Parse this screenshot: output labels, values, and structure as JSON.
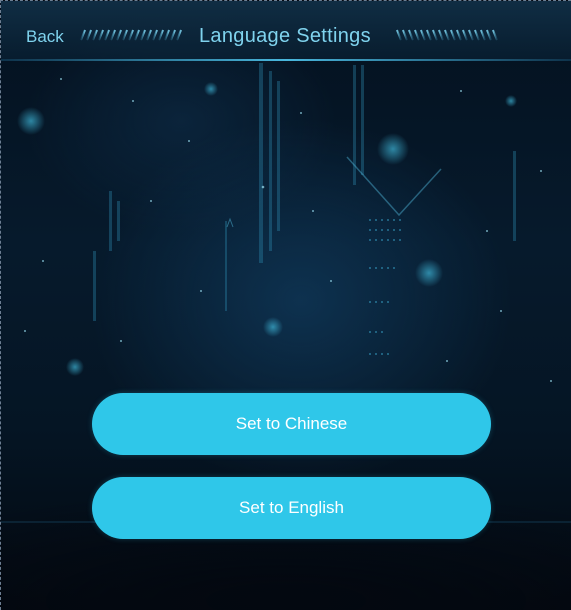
{
  "header": {
    "back_label": "Back",
    "title": "Language Settings"
  },
  "buttons": {
    "chinese_label": "Set to Chinese",
    "english_label": "Set to English"
  },
  "colors": {
    "accent": "#2fc7e9",
    "header_text": "#7fd3ee",
    "background": "#04111f",
    "button_text": "#ffffff"
  }
}
